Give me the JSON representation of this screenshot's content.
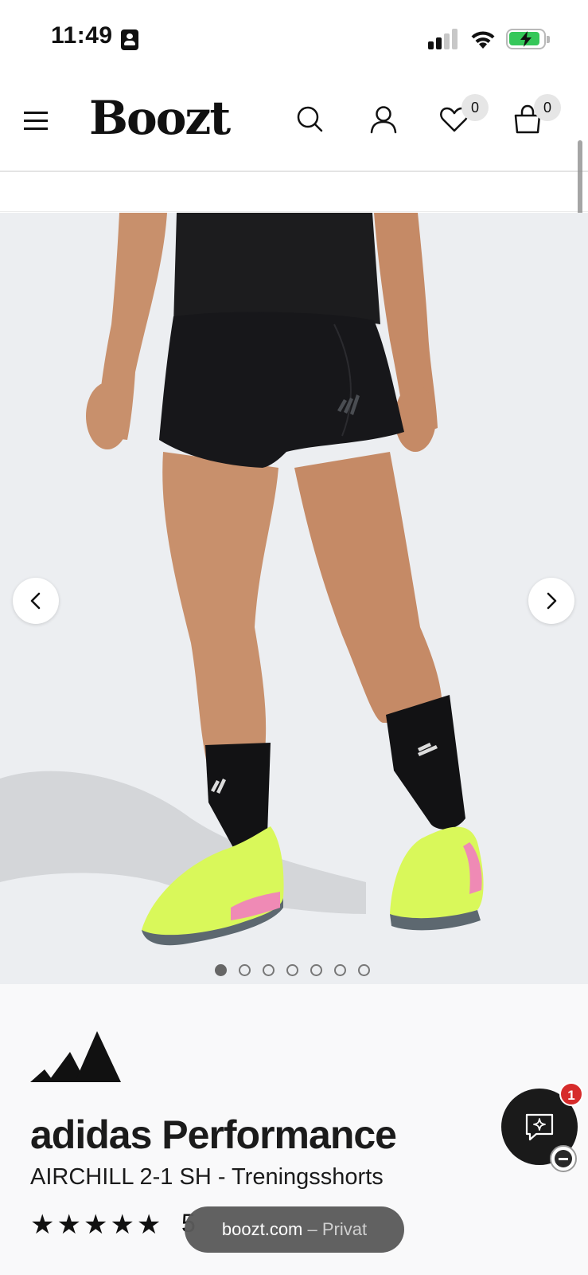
{
  "status_bar": {
    "time": "11:49"
  },
  "header": {
    "logo": "Boozt",
    "wishlist_count": "0",
    "cart_count": "0",
    "icons": [
      "menu-icon",
      "search-icon",
      "account-icon",
      "heart-icon",
      "bag-icon"
    ]
  },
  "gallery": {
    "image_count": 7,
    "active_index": 0,
    "alt": "AIRCHILL 2-1 SH shorts"
  },
  "product": {
    "brand": "adidas Performance",
    "name": "AIRCHILL 2-1 SH - Treningsshorts",
    "stars": "★★★★★",
    "rating_partial": "5"
  },
  "browser": {
    "host": "boozt.com",
    "mode": " – Privat"
  },
  "chat": {
    "unread": "1"
  },
  "colors": {
    "accent": "#111111",
    "chat_badge": "#d62b2b",
    "image_bg": "#eceef1",
    "sneaker": "#d9f85a"
  }
}
